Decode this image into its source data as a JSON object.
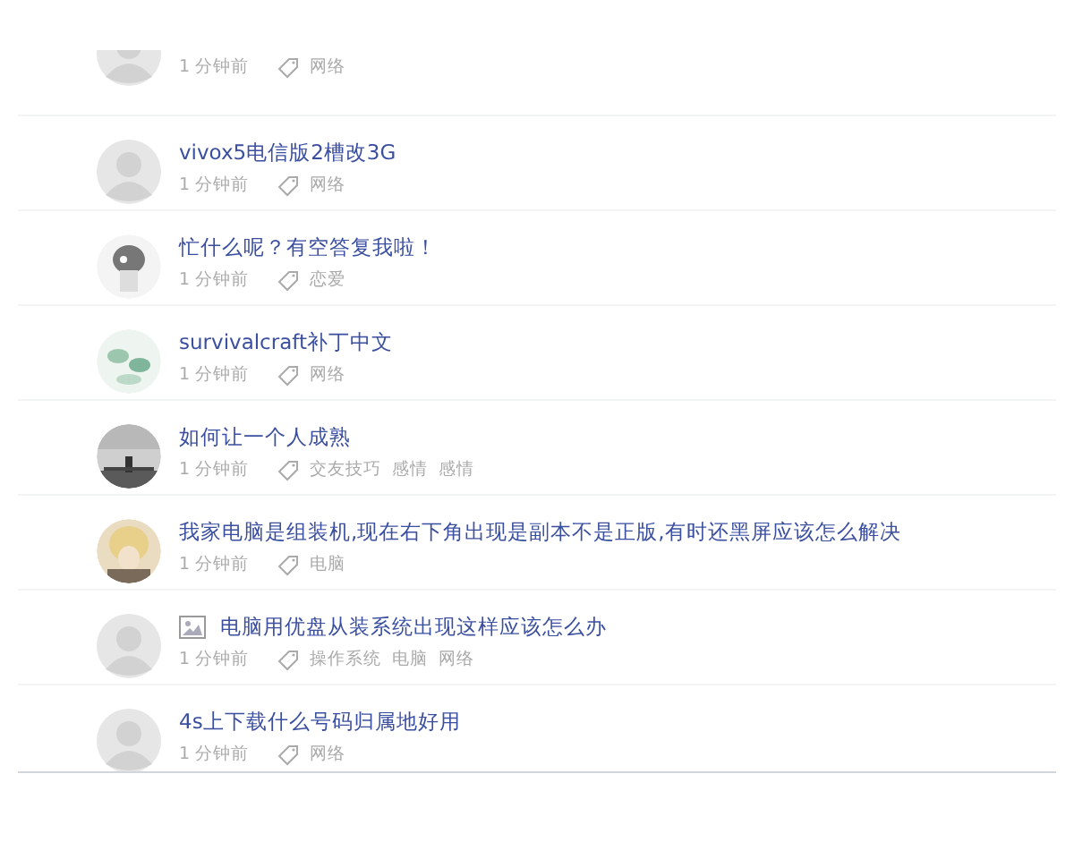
{
  "questions": [
    {
      "kind": "default",
      "time": "1 分钟前",
      "tags": [
        "网络"
      ]
    },
    {
      "kind": "default",
      "title": "vivox5电信版2槽改3G",
      "time": "1 分钟前",
      "tags": [
        "网络"
      ],
      "has_image": false
    },
    {
      "title": "忙什么呢？有空答复我啦！",
      "time": "1 分钟前",
      "tags": [
        "恋爱"
      ],
      "has_image": false
    },
    {
      "title": "survivalcraft补丁中文",
      "time": "1 分钟前",
      "tags": [
        "网络"
      ],
      "has_image": false
    },
    {
      "title": "如何让一个人成熟",
      "time": "1 分钟前",
      "tags": [
        "交友技巧",
        "感情",
        "感情"
      ],
      "has_image": false
    },
    {
      "title": "我家电脑是组装机,现在右下角出现是副本不是正版,有时还黑屏应该怎么解决",
      "time": "1 分钟前",
      "tags": [
        "电脑"
      ],
      "has_image": false
    },
    {
      "kind": "default",
      "title": "电脑用优盘从装系统出现这样应该怎么办",
      "time": "1 分钟前",
      "tags": [
        "操作系统",
        "电脑",
        "网络"
      ],
      "has_image": true
    },
    {
      "kind": "default",
      "title": "4s上下载什么号码归属地好用",
      "time": "1 分钟前",
      "tags": [
        "网络"
      ],
      "has_image": false
    }
  ]
}
